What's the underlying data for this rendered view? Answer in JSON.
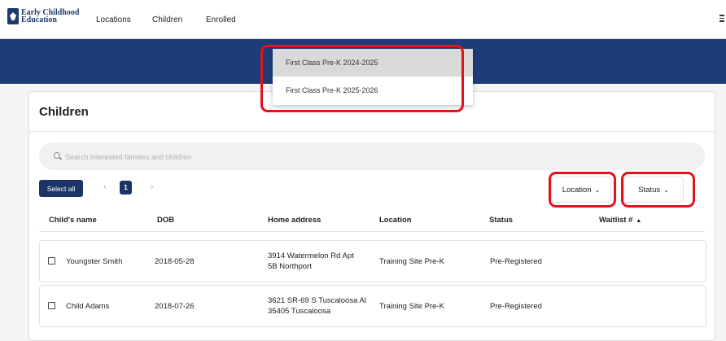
{
  "brand": {
    "line1": "Early Childhood",
    "line2": "Education"
  },
  "nav": [
    "Locations",
    "Children",
    "Enrolled"
  ],
  "dropdown": {
    "options": [
      "First Class Pre-K 2024-2025",
      "First Class Pre-K 2025-2026"
    ],
    "selected": "First Class Pre-K 2024-2025"
  },
  "page": {
    "title": "Children"
  },
  "search": {
    "placeholder": "Search interested families and children",
    "value": ""
  },
  "toolbar": {
    "select_all": "Select all",
    "prev": "‹",
    "next": "›",
    "current_page": "1"
  },
  "filters": {
    "location": "Location",
    "status": "Status",
    "chevron": "⌄"
  },
  "table": {
    "columns": [
      "Child's name",
      "DOB",
      "Home address",
      "Location",
      "Status",
      "Waitlist #"
    ],
    "sort_indicator": "▲",
    "rows": [
      {
        "name": "Youngster Smith",
        "dob": "2018-05-28",
        "address1": "3914 Watermelon Rd Apt",
        "address2": "5B Northport",
        "location": "Training Site Pre-K",
        "status": "Pre-Registered",
        "waitlist": ""
      },
      {
        "name": "Child Adams",
        "dob": "2018-07-26",
        "address1": "3621 SR-69 S Tuscaloosa Al",
        "address2": "35405 Tuscaloosa",
        "location": "Training Site Pre-K",
        "status": "Pre-Registered",
        "waitlist": ""
      }
    ]
  },
  "highlight_color": "#e2131a"
}
